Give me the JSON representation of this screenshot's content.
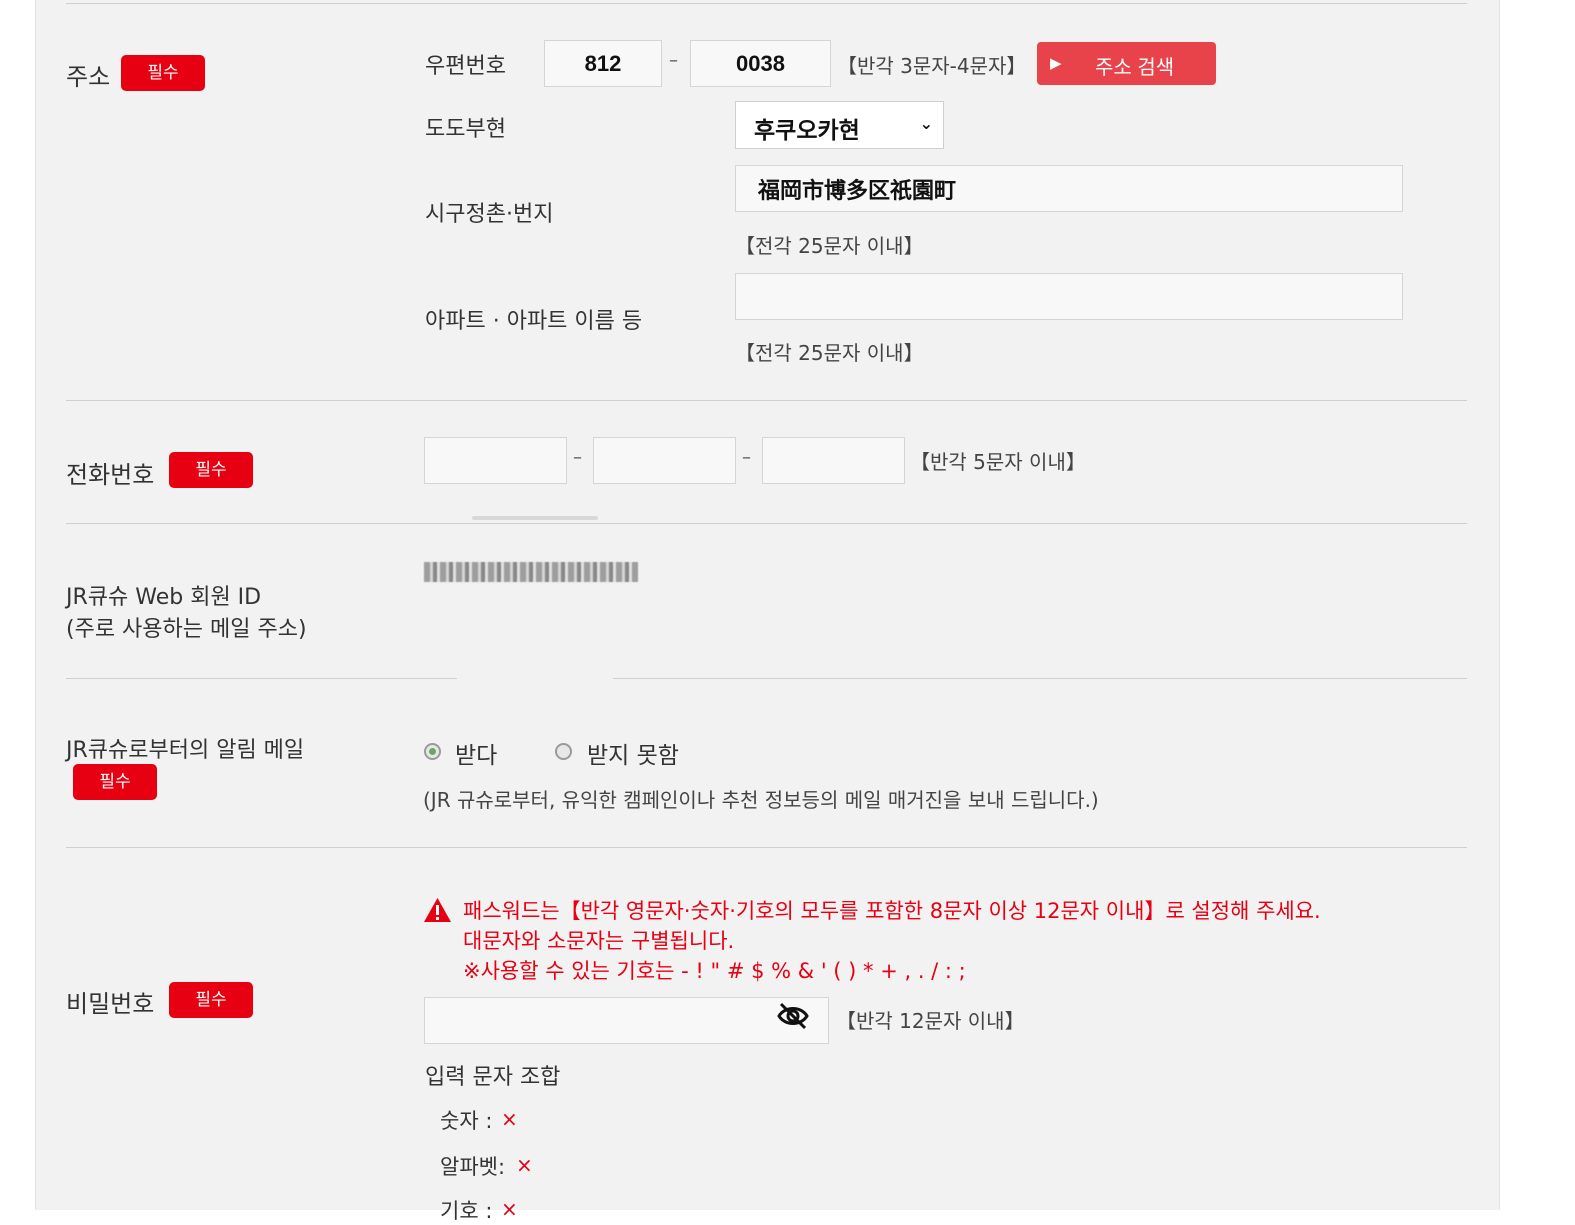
{
  "required_badge": "필수",
  "address": {
    "label": "주소",
    "postal_label": "우편번호",
    "postal_1": "812",
    "postal_sep": "–",
    "postal_2": "0038",
    "postal_hint": "【반각 3문자-4문자】",
    "search_button": "주소 검색",
    "prefecture_label": "도도부현",
    "prefecture_value": "후쿠오카현",
    "city_label": "시구정촌·번지",
    "city_value": "福岡市博多区祇園町",
    "city_hint": "【전각 25문자 이내】",
    "apartment_label": "아파트 · 아파트 이름 등",
    "apartment_value": "",
    "apartment_hint": "【전각 25문자 이내】"
  },
  "phone": {
    "label": "전화번호",
    "part1": "",
    "part2": "",
    "part3": "",
    "sep": "–",
    "hint": "【반각 5문자 이내】"
  },
  "member_id": {
    "label_line1": "JR큐슈 Web 회원 ID",
    "label_line2": "(주로 사용하는 메일 주소)"
  },
  "notification": {
    "label": "JR큐슈로부터의 알림 메일",
    "option_receive": "받다",
    "option_decline": "받지 못함",
    "selected": "받다",
    "note": "(JR 규슈로부터, 유익한 캠페인이나 추천 정보등의 메일 매거진을 보내 드립니다.)"
  },
  "password": {
    "label": "비밀번호",
    "warning_line1": "패스워드는【반각 영문자·숫자·기호의 모두를 포함한 8문자 이상 12문자 이내】로 설정해 주세요.",
    "warning_line2": "대문자와 소문자는 구별됩니다.",
    "warning_line3": "※사용할 수 있는 기호는 - ! \" # $ % & ' ( ) * + , . / : ;",
    "value": "",
    "hint": "【반각 12문자 이내】",
    "combo_title": "입력 문자 조합",
    "check_digits": "숫자 :",
    "check_alpha": "알파벳:",
    "check_symbol": "기호 :",
    "check_mark": "×"
  },
  "colors": {
    "accent_red": "#e60012",
    "search_button": "#e8434b",
    "panel_bg": "#f2f2f2"
  }
}
